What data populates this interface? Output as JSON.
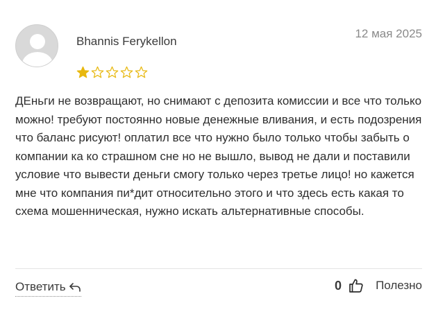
{
  "review": {
    "author": "Bhannis Ferykellon",
    "date": "12 мая 2025",
    "rating": 1,
    "max_rating": 5,
    "text": "ДЕньги не возвращают, но снимают с депозита комиссии и все что только можно! требуют постоянно новые денежные вливания, и есть подозрения что баланс рисуют! оплатил все что нужно было только чтобы забыть о компании ка ко страшном сне но не вышло, вывод не дали и поставили условие что вывести деньги смогу только через третье лицо! но кажется мне что компания пи*дит относительно этого и что здесь есть какая то схема мошенническая, нужно искать альтернативные способы."
  },
  "actions": {
    "reply_label": "Ответить",
    "helpful_count": "0",
    "helpful_label": "Полезно"
  },
  "icons": {
    "avatar": "user-avatar-placeholder",
    "reply": "reply-arrow-icon",
    "helpful": "thumbs-up-icon",
    "star_filled": "star-filled-icon",
    "star_empty": "star-outline-icon"
  },
  "colors": {
    "star": "#e8b80f",
    "divider": "#e3e3e3"
  }
}
